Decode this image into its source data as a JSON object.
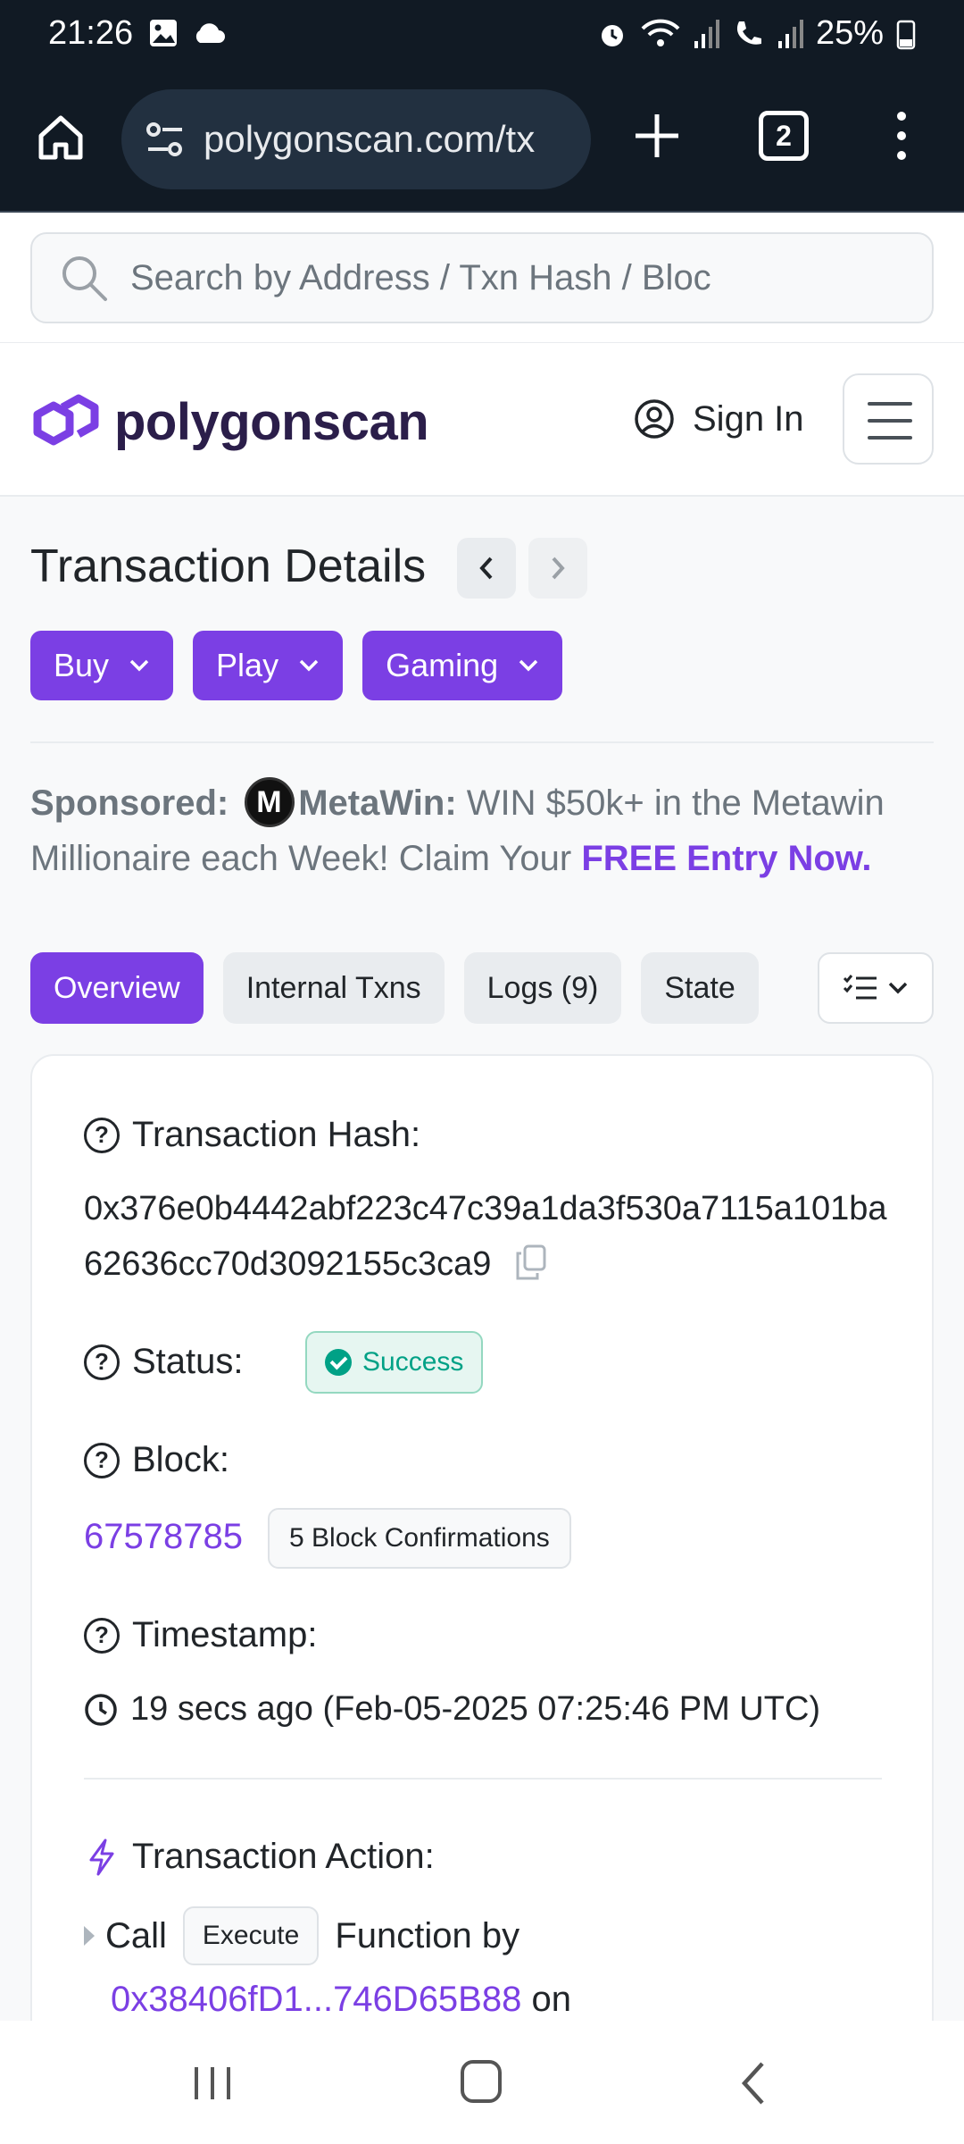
{
  "status_bar": {
    "time": "21:26",
    "battery": "25%"
  },
  "browser": {
    "url": "polygonscan.com/tx",
    "tab_count": "2"
  },
  "search": {
    "placeholder": "Search by Address / Txn Hash / Bloc"
  },
  "header": {
    "logo_text": "polygonscan",
    "sign_in": "Sign In"
  },
  "page": {
    "title": "Transaction Details",
    "buttons": [
      "Buy",
      "Play",
      "Gaming"
    ]
  },
  "sponsored": {
    "label": "Sponsored:",
    "brand": "MetaWin:",
    "text": " WIN $50k+ in the Metawin Millionaire each Week! Claim Your ",
    "cta": "FREE Entry Now."
  },
  "tabs": [
    "Overview",
    "Internal Txns",
    "Logs (9)",
    "State"
  ],
  "details": {
    "hash_label": "Transaction Hash:",
    "hash": "0x376e0b4442abf223c47c39a1da3f530a7115a101ba62636cc70d3092155c3ca9",
    "status_label": "Status:",
    "status": "Success",
    "block_label": "Block:",
    "block": "67578785",
    "confirmations": "5 Block Confirmations",
    "timestamp_label": "Timestamp:",
    "timestamp": "19 secs ago (Feb-05-2025 07:25:46 PM UTC)",
    "action_label": "Transaction Action:",
    "call": "Call",
    "execute": "Execute",
    "function_by": "Function by",
    "from_addr": "0x38406fD1...746D65B88",
    "on": "on"
  },
  "colors": {
    "accent": "#7b3fe4",
    "success": "#00a186",
    "chrome_bg": "#111a24"
  }
}
